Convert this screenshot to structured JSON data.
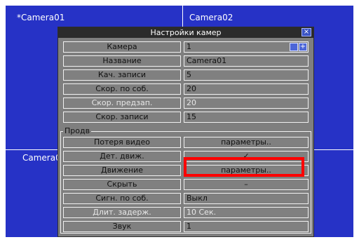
{
  "screen": {
    "camera_labels": [
      "*Camera01",
      "Camera02",
      "Camera0"
    ]
  },
  "dialog": {
    "title": "Настройки камер",
    "close_icon": "×",
    "rows_top": [
      {
        "label": "Камера",
        "value": "1"
      },
      {
        "label": "Название",
        "value": "Camera01"
      },
      {
        "label": "Кач. записи",
        "value": "5"
      },
      {
        "label": "Скор. по соб.",
        "value": "20"
      },
      {
        "label": "Скор. предзап.",
        "value": "20"
      },
      {
        "label": "Скор. записи",
        "value": "15"
      }
    ],
    "group_label": "Продв",
    "rows_group": [
      {
        "label": "Потеря видео",
        "value": "параметры.."
      },
      {
        "label": "Дет. движ.",
        "value": "✓"
      },
      {
        "label": "Движение",
        "value": "параметры.."
      },
      {
        "label": "Скрыть",
        "value": "–"
      },
      {
        "label": "Сигн. по соб.",
        "value": "Выкл"
      },
      {
        "label": "Длит. задерж.",
        "value": "10 Сек."
      },
      {
        "label": "Звук",
        "value": "1"
      }
    ]
  },
  "colors": {
    "screen_bg": "#2632c6",
    "dialog_bg": "#7f7f7f",
    "title_bg": "#2b2b2b",
    "highlight": "#ff0000"
  }
}
